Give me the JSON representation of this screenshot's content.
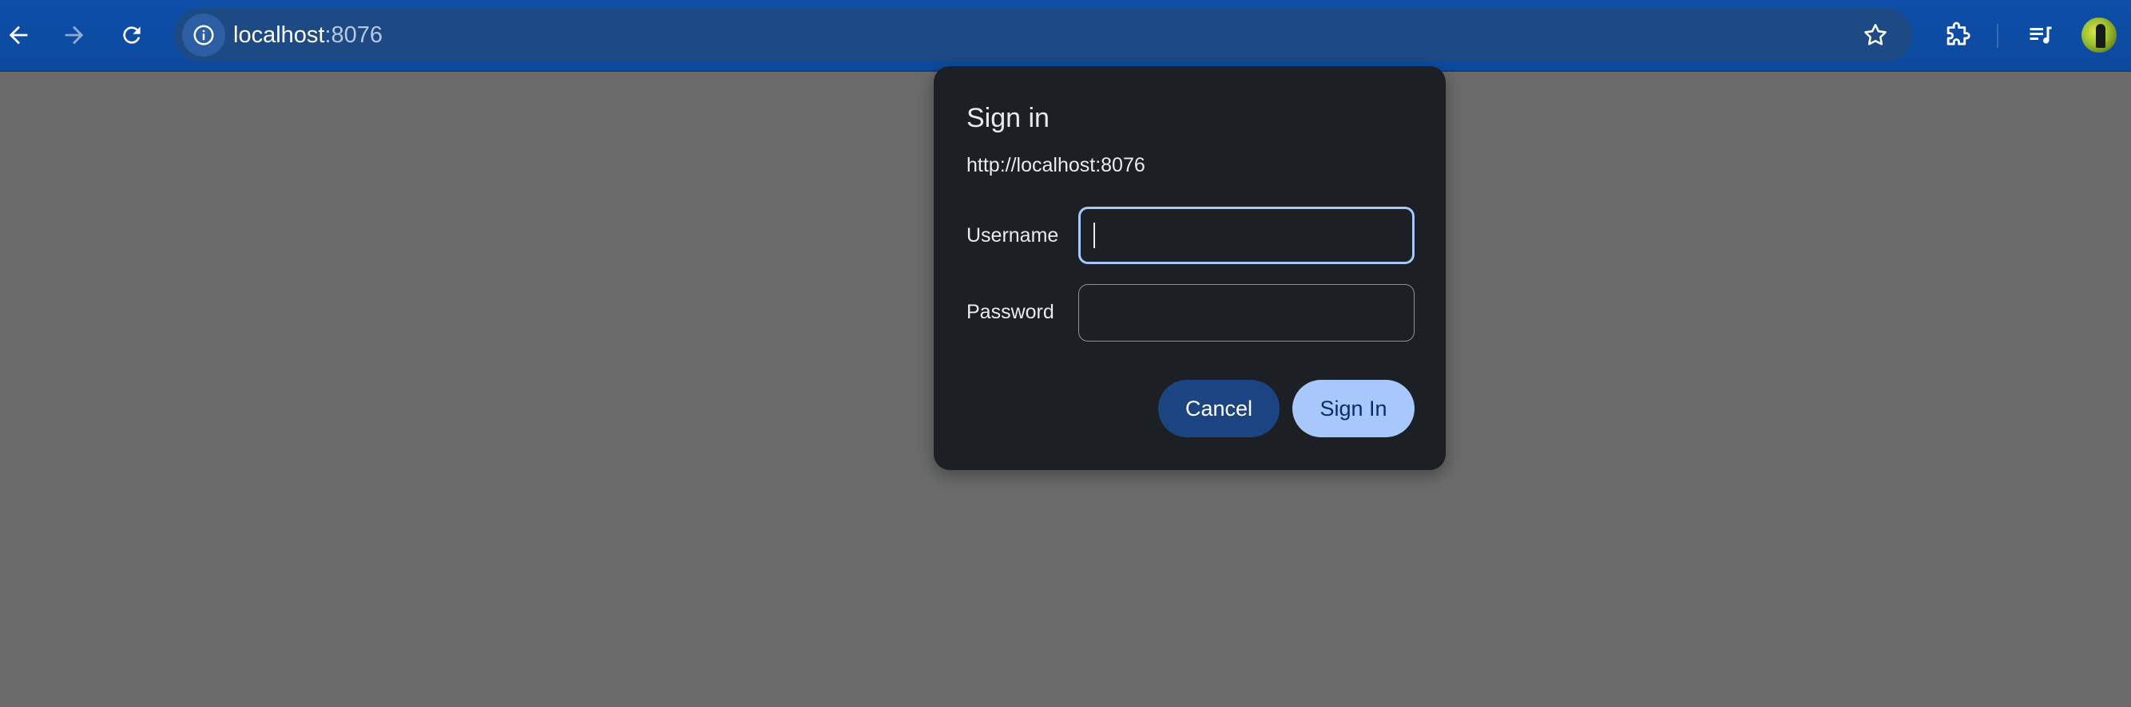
{
  "browser": {
    "url_host": "localhost",
    "url_port": ":8076",
    "icons": {
      "back": "back-arrow-icon",
      "forward": "forward-arrow-icon",
      "reload": "reload-icon",
      "site_info": "info-icon",
      "bookmark": "star-icon",
      "extensions": "puzzle-icon",
      "media": "media-queue-icon",
      "profile": "avatar"
    },
    "colors": {
      "toolbar": "#0c4a9f",
      "omnibox": "#1d4a85",
      "page_background": "#6b6b6b"
    }
  },
  "dialog": {
    "title": "Sign in",
    "origin": "http://localhost:8076",
    "username_label": "Username",
    "username_value": "",
    "password_label": "Password",
    "password_value": "",
    "cancel_label": "Cancel",
    "signin_label": "Sign In",
    "colors": {
      "background": "#1c1f24",
      "focus_border": "#a8c7fa",
      "cancel_button": "#1d4482",
      "signin_button": "#a8c7fa"
    }
  }
}
